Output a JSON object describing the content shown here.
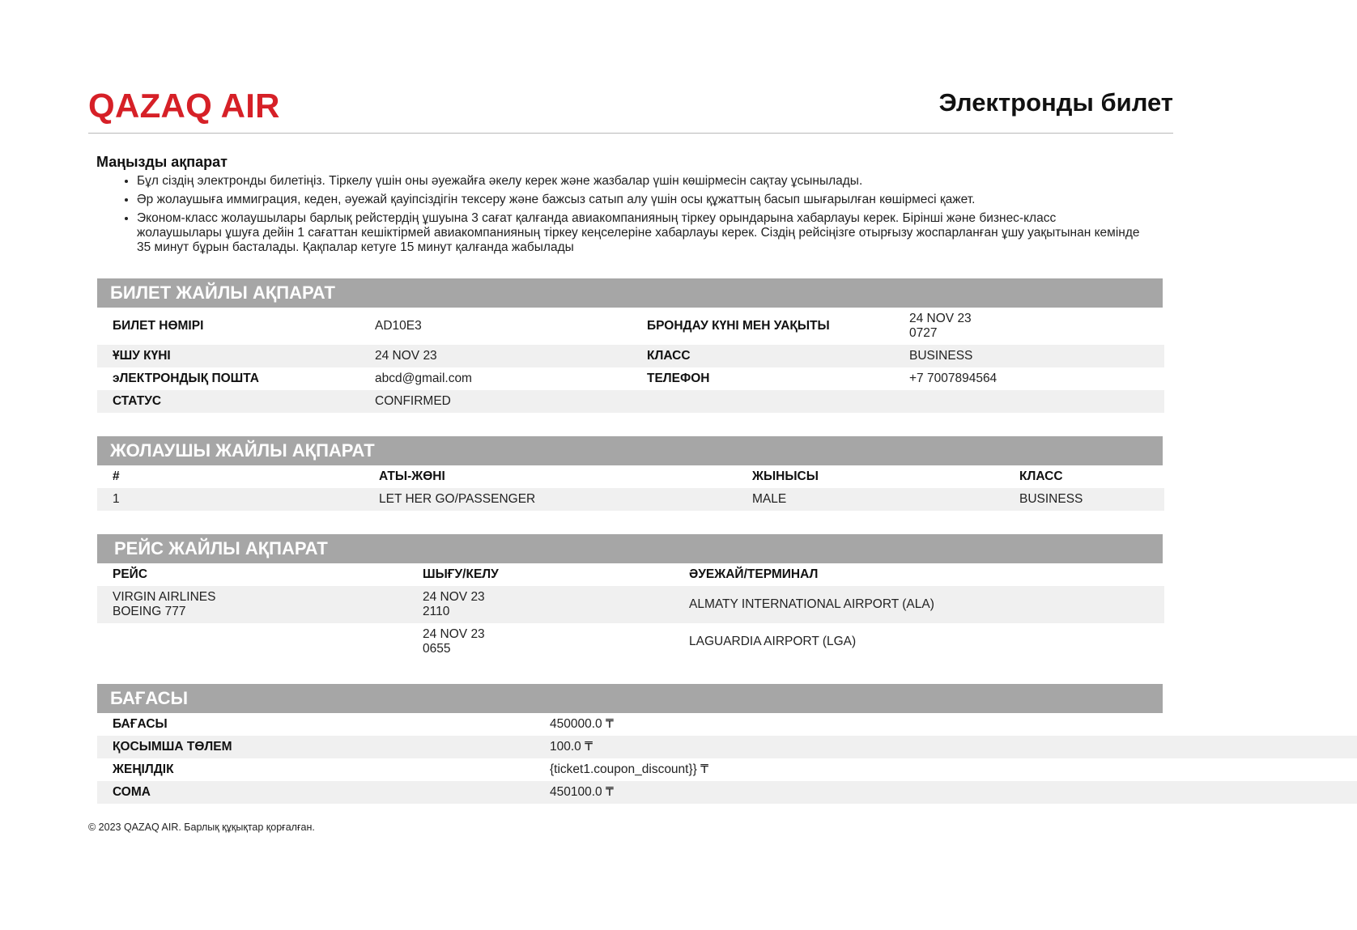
{
  "header": {
    "brand": "QAZAQ AIR",
    "title": "Электронды билет"
  },
  "info": {
    "title": "Маңызды ақпарат",
    "items": [
      "Бұл сіздің электронды билетіңіз. Тіркелу үшін оны әуежайға әкелу керек және жазбалар үшін көшірмесін сақтау ұсынылады.",
      "Әр жолаушыға иммиграция, кеден, әуежай қауіпсіздігін тексеру және бажсыз сатып алу үшін осы құжаттың басып шығарылған көшірмесі қажет.",
      "Эконом-класс жолаушылары барлық рейстердің ұшуына 3 сағат қалғанда авиакомпанияның тіркеу орындарына хабарлауы керек. Бірінші және бизнес-класс жолаушылары ұшуға дейін 1 сағаттан кешіктірмей авиакомпанияның тіркеу кеңселеріне хабарлауы керек. Сіздің рейсіңізге отырғызу жоспарланған ұшу уақытынан кемінде 35 минут бұрын басталады. Қақпалар кетуге 15 минут қалғанда жабылады"
    ]
  },
  "ticket": {
    "heading": "БИЛЕТ ЖАЙЛЫ АҚПАРАТ",
    "ticket_number_label": "БИЛЕТ НӨМІРІ",
    "ticket_number": "AD10E3",
    "booking_label": "БРОНДАУ КҮНІ МЕН УАҚЫТЫ",
    "booking_date": "24 NOV 23",
    "booking_time": "0727",
    "flight_date_label": "ҰШУ КҮНІ",
    "flight_date": "24 NOV 23",
    "class_label": "КЛАСС",
    "class_value": "BUSINESS",
    "email_label": "эЛЕКТРОНДЫҚ ПОШТА",
    "email": "abcd@gmail.com",
    "phone_label": "ТЕЛЕФОН",
    "phone": "+7 7007894564",
    "status_label": "СТАТУС",
    "status": "CONFIRMED"
  },
  "passenger": {
    "heading": "ЖОЛАУШЫ ЖАЙЛЫ АҚПАРАТ",
    "columns": [
      "#",
      "АТЫ-ЖӨНІ",
      "ЖЫНЫСЫ",
      "КЛАСС"
    ],
    "rows": [
      [
        "1",
        "LET HER GO/PASSENGER",
        "MALE",
        "BUSINESS"
      ]
    ]
  },
  "flight": {
    "heading": "РЕЙС ЖАЙЛЫ АҚПАРАТ",
    "columns": [
      "РЕЙС",
      "ШЫҒУ/КЕЛУ",
      "ӘУЕЖАЙ/ТЕРМИНАЛ"
    ],
    "airline": "VIRGIN AIRLINES",
    "aircraft": "BOEING 777",
    "departure_date": "24 NOV 23",
    "departure_time": "2110",
    "departure_airport": "ALMATY INTERNATIONAL AIRPORT (ALA)",
    "arrival_date": "24 NOV 23",
    "arrival_time": "0655",
    "arrival_airport": "LAGUARDIA AIRPORT (LGA)"
  },
  "price": {
    "heading": "БАҒАСЫ",
    "rows": [
      {
        "label": "БАҒАСЫ",
        "value": "450000.0 ₸"
      },
      {
        "label": "ҚОСЫМША ТӨЛЕМ",
        "value": "100.0 ₸"
      },
      {
        "label": "ЖЕҢІЛДІК",
        "value": "{ticket1.coupon_discount}} ₸"
      },
      {
        "label": "СОМА",
        "value": "450100.0 ₸"
      }
    ]
  },
  "footer": "© 2023 QAZAQ AIR. Барлық құқықтар қорғалған."
}
